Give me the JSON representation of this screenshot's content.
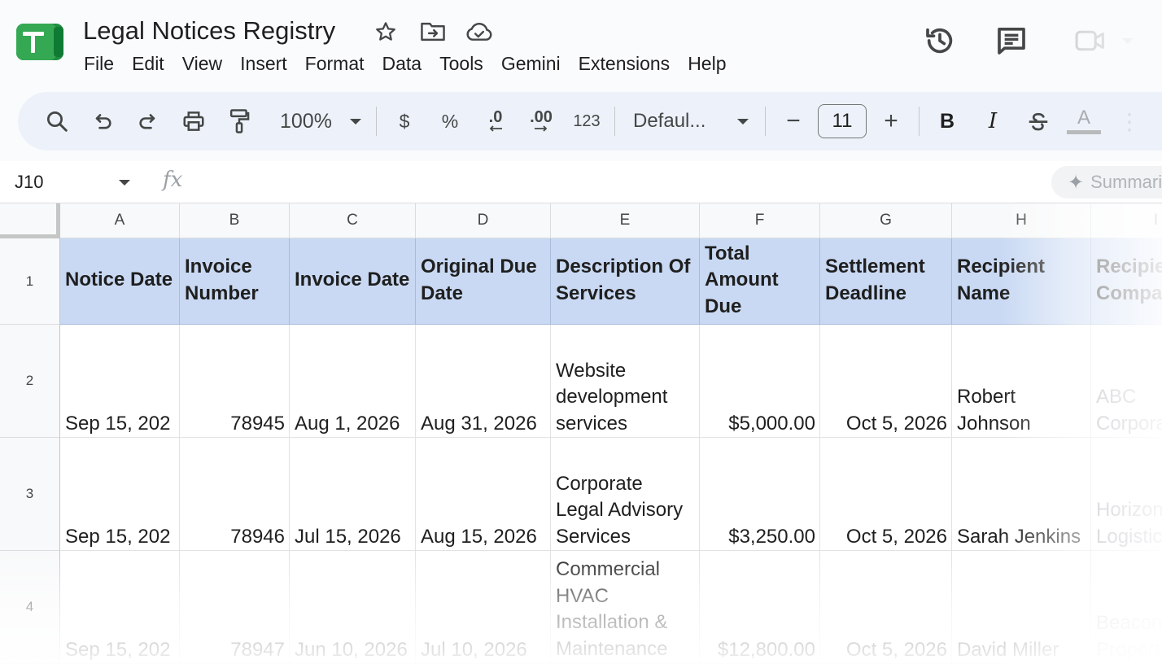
{
  "app": {
    "doc_title": "Legal Notices Registry",
    "menu": [
      "File",
      "Edit",
      "View",
      "Insert",
      "Format",
      "Data",
      "Tools",
      "Gemini",
      "Extensions",
      "Help"
    ],
    "icons": {
      "star": "star-icon",
      "move": "move-to-folder-icon",
      "cloud": "cloud-saved-icon",
      "history": "version-history-icon",
      "comments": "comments-icon",
      "meet": "video-call-icon"
    },
    "accent_color": "#34a853"
  },
  "toolbar": {
    "zoom": "100%",
    "currency": "$",
    "percent": "%",
    "decrease_decimal": ".0",
    "increase_decimal": ".00",
    "number_format": "123",
    "font": "Defaul...",
    "font_size": "11",
    "minus": "−",
    "plus": "+",
    "bold": "B",
    "italic": "I",
    "text_color": "A"
  },
  "formula_bar": {
    "name_box": "J10",
    "fx": "fx",
    "summarize": "Summarize"
  },
  "sheet": {
    "columns": [
      "A",
      "B",
      "C",
      "D",
      "E",
      "F",
      "G",
      "H",
      "I"
    ],
    "row_numbers": [
      "1",
      "2",
      "3",
      "4"
    ],
    "headers": [
      "Notice Date",
      "Invoice Number",
      "Invoice Date",
      "Original Due Date",
      "Description Of Services",
      "Total Amount Due",
      "Settlement Deadline",
      "Recipient Name",
      "Recipient Company"
    ],
    "header_color": "#c9d9f3",
    "rows": [
      [
        "Sep 15, 202",
        "78945",
        "Aug 1, 2026",
        "Aug 31, 2026",
        "Website development services",
        "$5,000.00",
        "Oct 5, 2026",
        "Robert Johnson",
        "ABC Corporation"
      ],
      [
        "Sep 15, 202",
        "78946",
        "Jul 15, 2026",
        "Aug 15, 2026",
        "Corporate Legal Advisory Services",
        "$3,250.00",
        "Oct 5, 2026",
        "Sarah Jenkins",
        "Horizon Logistics"
      ],
      [
        "Sep 15, 202",
        "78947",
        "Jun 10, 2026",
        "Jul 10, 2026",
        "Commercial HVAC Installation & Maintenance",
        "$12,800.00",
        "Oct 5, 2026",
        "David Miller",
        "Beacon Properties"
      ]
    ]
  }
}
